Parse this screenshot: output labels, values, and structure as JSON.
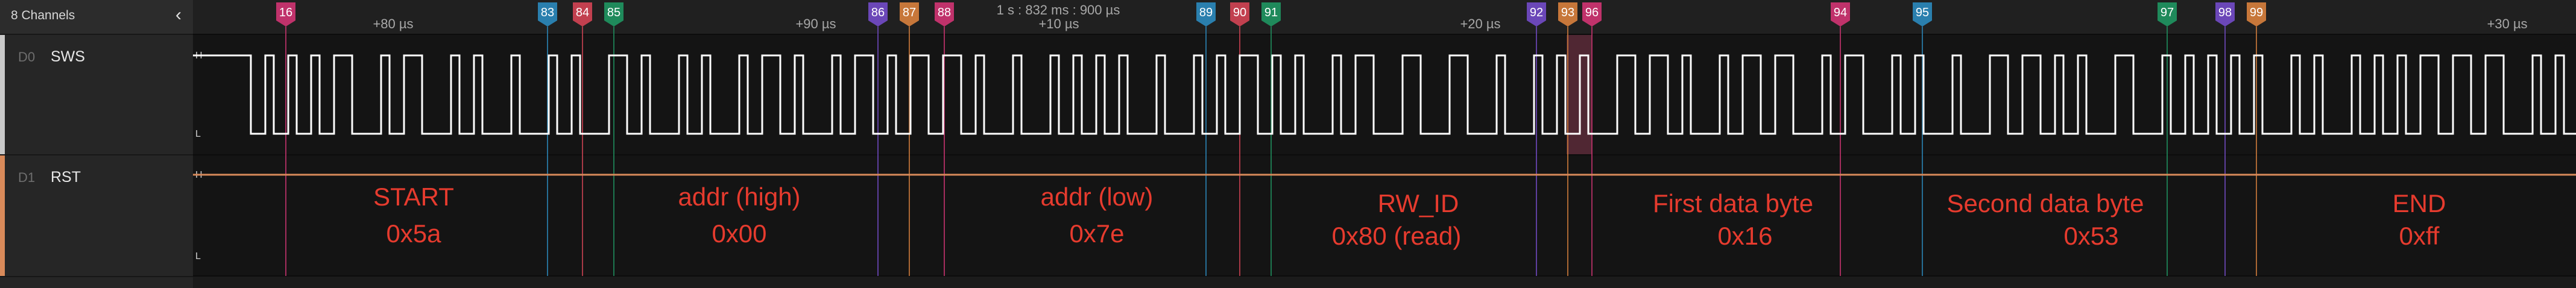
{
  "sidebar": {
    "title": "8 Channels",
    "collapse_icon": "chevron-left-icon",
    "channels": [
      {
        "id": "D0",
        "name": "SWS",
        "color": "#c9c9c9"
      },
      {
        "id": "D1",
        "name": "RST",
        "color": "#d98a5a"
      }
    ]
  },
  "timeline": {
    "time_labels": [
      "+80 µs",
      "+90 µs",
      "+10 µs",
      "+20 µs",
      "+30 µs"
    ],
    "center_readout": "1 s : 832 ms : 900 µs",
    "level_high": "H",
    "level_low": "L"
  },
  "markers": [
    {
      "label": "16",
      "color": "#c0326b"
    },
    {
      "label": "83",
      "color": "#2a7fae"
    },
    {
      "label": "84",
      "color": "#c2404f"
    },
    {
      "label": "85",
      "color": "#1f8a5b"
    },
    {
      "label": "86",
      "color": "#6b47b8"
    },
    {
      "label": "87",
      "color": "#c7773a"
    },
    {
      "label": "88",
      "color": "#c0326b"
    },
    {
      "label": "89",
      "color": "#2a7fae"
    },
    {
      "label": "90",
      "color": "#c2404f"
    },
    {
      "label": "91",
      "color": "#1f8a5b"
    },
    {
      "label": "92",
      "color": "#6b47b8"
    },
    {
      "label": "93",
      "color": "#c7773a"
    },
    {
      "label": "96",
      "color": "#c0326b"
    },
    {
      "label": "94",
      "color": "#c0326b"
    },
    {
      "label": "95",
      "color": "#2a7fae"
    },
    {
      "label": "97",
      "color": "#1f8a5b"
    },
    {
      "label": "98",
      "color": "#6b47b8"
    },
    {
      "label": "99",
      "color": "#c7773a"
    }
  ],
  "annotations": [
    {
      "title": "START",
      "value": "0x5a"
    },
    {
      "title": "addr (high)",
      "value": "0x00"
    },
    {
      "title": "addr (low)",
      "value": "0x7e"
    },
    {
      "title": "RW_ID",
      "value": "0x80 (read)"
    },
    {
      "title": "First data byte",
      "value": "0x16"
    },
    {
      "title": "Second data byte",
      "value": "0x53"
    },
    {
      "title": "END",
      "value": "0xff"
    }
  ],
  "colors": {
    "annotation_text": "#e63b2e",
    "signal_line": "#ffffff",
    "rst_line": "#d98a5a",
    "selection_band": "#5a2a38"
  }
}
